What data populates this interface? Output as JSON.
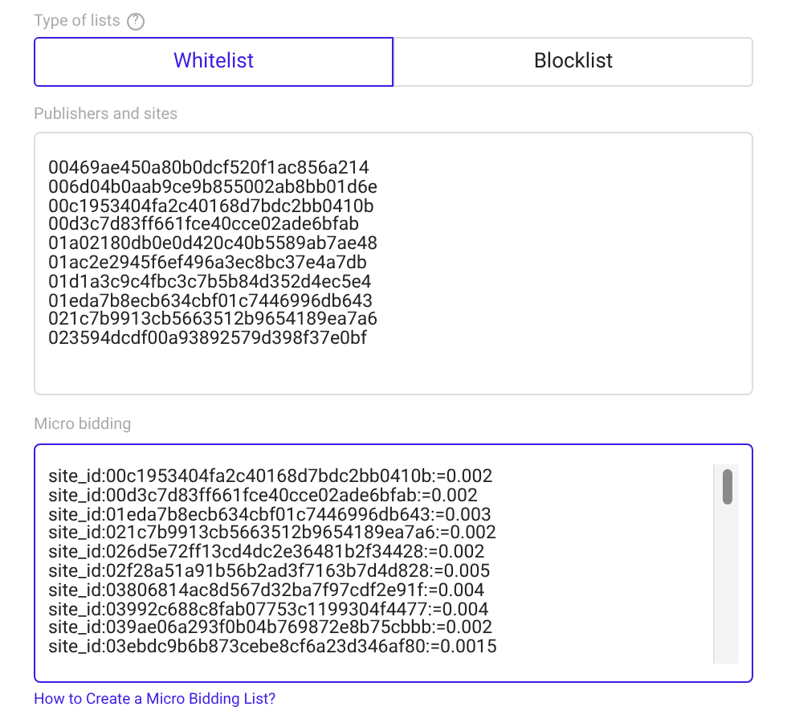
{
  "type_of_lists": {
    "label": "Type of lists",
    "help": "?",
    "tabs": [
      {
        "label": "Whitelist",
        "selected": true
      },
      {
        "label": "Blocklist",
        "selected": false
      }
    ]
  },
  "publishers": {
    "label": "Publishers and sites",
    "lines": [
      "00469ae450a80b0dcf520f1ac856a214",
      "006d04b0aab9ce9b855002ab8bb01d6e",
      "00c1953404fa2c40168d7bdc2bb0410b",
      "00d3c7d83ff661fce40cce02ade6bfab",
      "01a02180db0e0d420c40b5589ab7ae48",
      "01ac2e2945f6ef496a3ec8bc37e4a7db",
      "01d1a3c9c4fbc3c7b5b84d352d4ec5e4",
      "01eda7b8ecb634cbf01c7446996db643",
      "021c7b9913cb5663512b9654189ea7a6",
      "023594dcdf00a93892579d398f37e0bf"
    ]
  },
  "micro_bidding": {
    "label": "Micro bidding",
    "focused": true,
    "lines": [
      "site_id:00c1953404fa2c40168d7bdc2bb0410b:=0.002",
      "site_id:00d3c7d83ff661fce40cce02ade6bfab:=0.002",
      "site_id:01eda7b8ecb634cbf01c7446996db643:=0.003",
      "site_id:021c7b9913cb5663512b9654189ea7a6:=0.002",
      "site_id:026d5e72ff13cd4dc2e36481b2f34428:=0.002",
      "site_id:02f28a51a91b56b2ad3f7163b7d4d828:=0.005",
      "site_id:03806814ac8d567d32ba7f97cdf2e91f:=0.004",
      "site_id:03992c688c8fab07753c1199304f4477:=0.004",
      "site_id:039ae06a293f0b04b769872e8b75cbbb:=0.002",
      "site_id:03ebdc9b6b873cebe8cf6a23d346af80:=0.0015"
    ],
    "link": "How to Create a Micro Bidding List?"
  }
}
